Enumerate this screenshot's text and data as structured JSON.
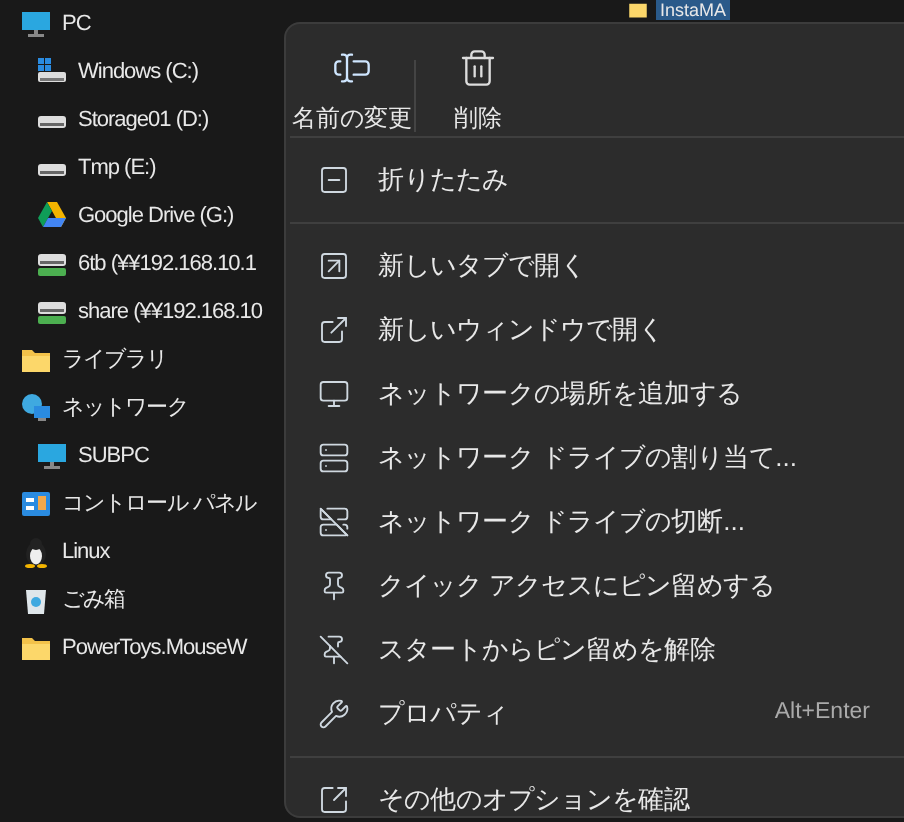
{
  "sidebar": {
    "items": [
      {
        "label": "PC",
        "children": [
          {
            "label": "Windows (C:)"
          },
          {
            "label": "Storage01 (D:)"
          },
          {
            "label": "Tmp (E:)"
          },
          {
            "label": "Google Drive (G:)"
          },
          {
            "label": "6tb (¥¥192.168.10.1"
          },
          {
            "label": "share (¥¥192.168.10"
          }
        ]
      },
      {
        "label": "ライブラリ"
      },
      {
        "label": "ネットワーク",
        "children": [
          {
            "label": "SUBPC"
          }
        ]
      },
      {
        "label": "コントロール パネル"
      },
      {
        "label": "Linux"
      },
      {
        "label": "ごみ箱"
      },
      {
        "label": "PowerToys.MouseW"
      }
    ]
  },
  "content": {
    "items": [
      {
        "label": "InstaMA"
      }
    ]
  },
  "context_menu": {
    "top_buttons": [
      {
        "label": "名前の変更"
      },
      {
        "label": "削除"
      }
    ],
    "groups": [
      [
        {
          "label": "折りたたみ"
        }
      ],
      [
        {
          "label": "新しいタブで開く"
        },
        {
          "label": "新しいウィンドウで開く"
        },
        {
          "label": "ネットワークの場所を追加する"
        },
        {
          "label": "ネットワーク ドライブの割り当て..."
        },
        {
          "label": "ネットワーク ドライブの切断..."
        },
        {
          "label": "クイック アクセスにピン留めする"
        },
        {
          "label": "スタートからピン留めを解除"
        },
        {
          "label": "プロパティ",
          "shortcut": "Alt+Enter"
        }
      ],
      [
        {
          "label": "その他のオプションを確認"
        }
      ]
    ]
  }
}
